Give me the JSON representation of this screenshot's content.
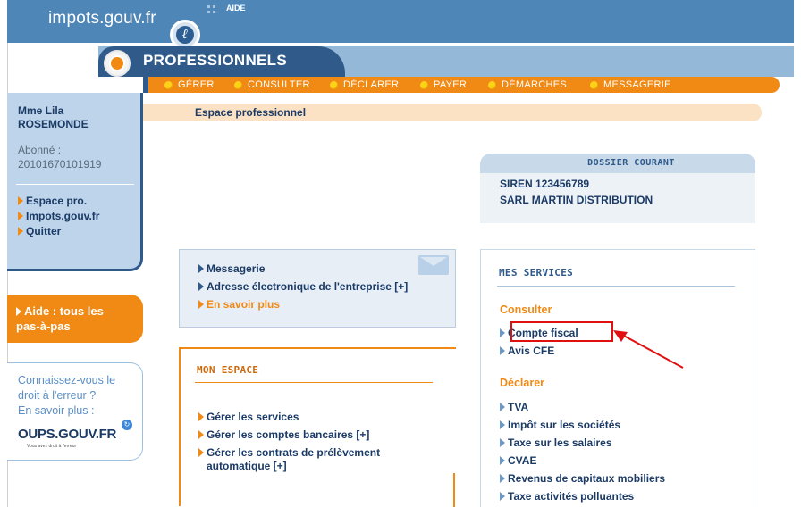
{
  "header": {
    "site": "impots.gouv.fr",
    "logo_glyph": "ℓ",
    "aide": "AIDE",
    "section": "PROFESSIONNELS"
  },
  "menu": [
    {
      "label": "GÉRER"
    },
    {
      "label": "CONSULTER"
    },
    {
      "label": "DÉCLARER"
    },
    {
      "label": "PAYER"
    },
    {
      "label": "DÉMARCHES"
    },
    {
      "label": "MESSAGERIE"
    }
  ],
  "breadcrumb": "Espace professionnel",
  "user": {
    "name_line1": "Mme  Lila",
    "name_line2": "ROSEMONDE",
    "abonne_label": "Abonné :",
    "abonne_number": "20101670101919"
  },
  "sidebar_links": [
    {
      "label": "Espace pro."
    },
    {
      "label": "Impots.gouv.fr"
    },
    {
      "label": "Quitter"
    }
  ],
  "aide_box": {
    "line1": "Aide : tous les",
    "line2": "pas-à-pas"
  },
  "oups": {
    "line1": "Connaissez-vous le",
    "line2": "droit à l'erreur ?",
    "line3": "En savoir plus :",
    "logo": "OUPS.GOUV.FR",
    "sub": "Vous avez droit à l'erreur",
    "badge": "↻"
  },
  "dossier": {
    "title": "DOSSIER COURANT",
    "siren": "SIREN 123456789",
    "company": "SARL MARTIN DISTRIBUTION"
  },
  "messagerie_box": {
    "links": [
      {
        "label": "Messagerie"
      },
      {
        "label": "Adresse électronique de l'entreprise [+]"
      },
      {
        "label": "En savoir plus"
      }
    ]
  },
  "mon_espace": {
    "title": "MON ESPACE",
    "links": [
      {
        "label": "Gérer les services"
      },
      {
        "label": "Gérer les comptes bancaires [+]"
      },
      {
        "label_line1": "Gérer les contrats de prélèvement",
        "label_line2": "automatique [+]"
      }
    ]
  },
  "mes_services": {
    "title": "MES SERVICES",
    "consulter": {
      "heading": "Consulter",
      "links": [
        {
          "label": "Compte fiscal"
        },
        {
          "label": "Avis CFE"
        }
      ]
    },
    "declarer": {
      "heading": "Déclarer",
      "links": [
        {
          "label": "TVA"
        },
        {
          "label": "Impôt sur les sociétés"
        },
        {
          "label": "Taxe sur les salaires"
        },
        {
          "label": "CVAE"
        },
        {
          "label": "Revenus de capitaux mobiliers"
        },
        {
          "label": "Taxe activités polluantes"
        }
      ]
    }
  },
  "colors": {
    "brand_blue": "#4f86b8",
    "dark_blue": "#2f5a8a",
    "orange": "#f08a14",
    "text_navy": "#1b3b66",
    "annotation_red": "#e01010"
  }
}
